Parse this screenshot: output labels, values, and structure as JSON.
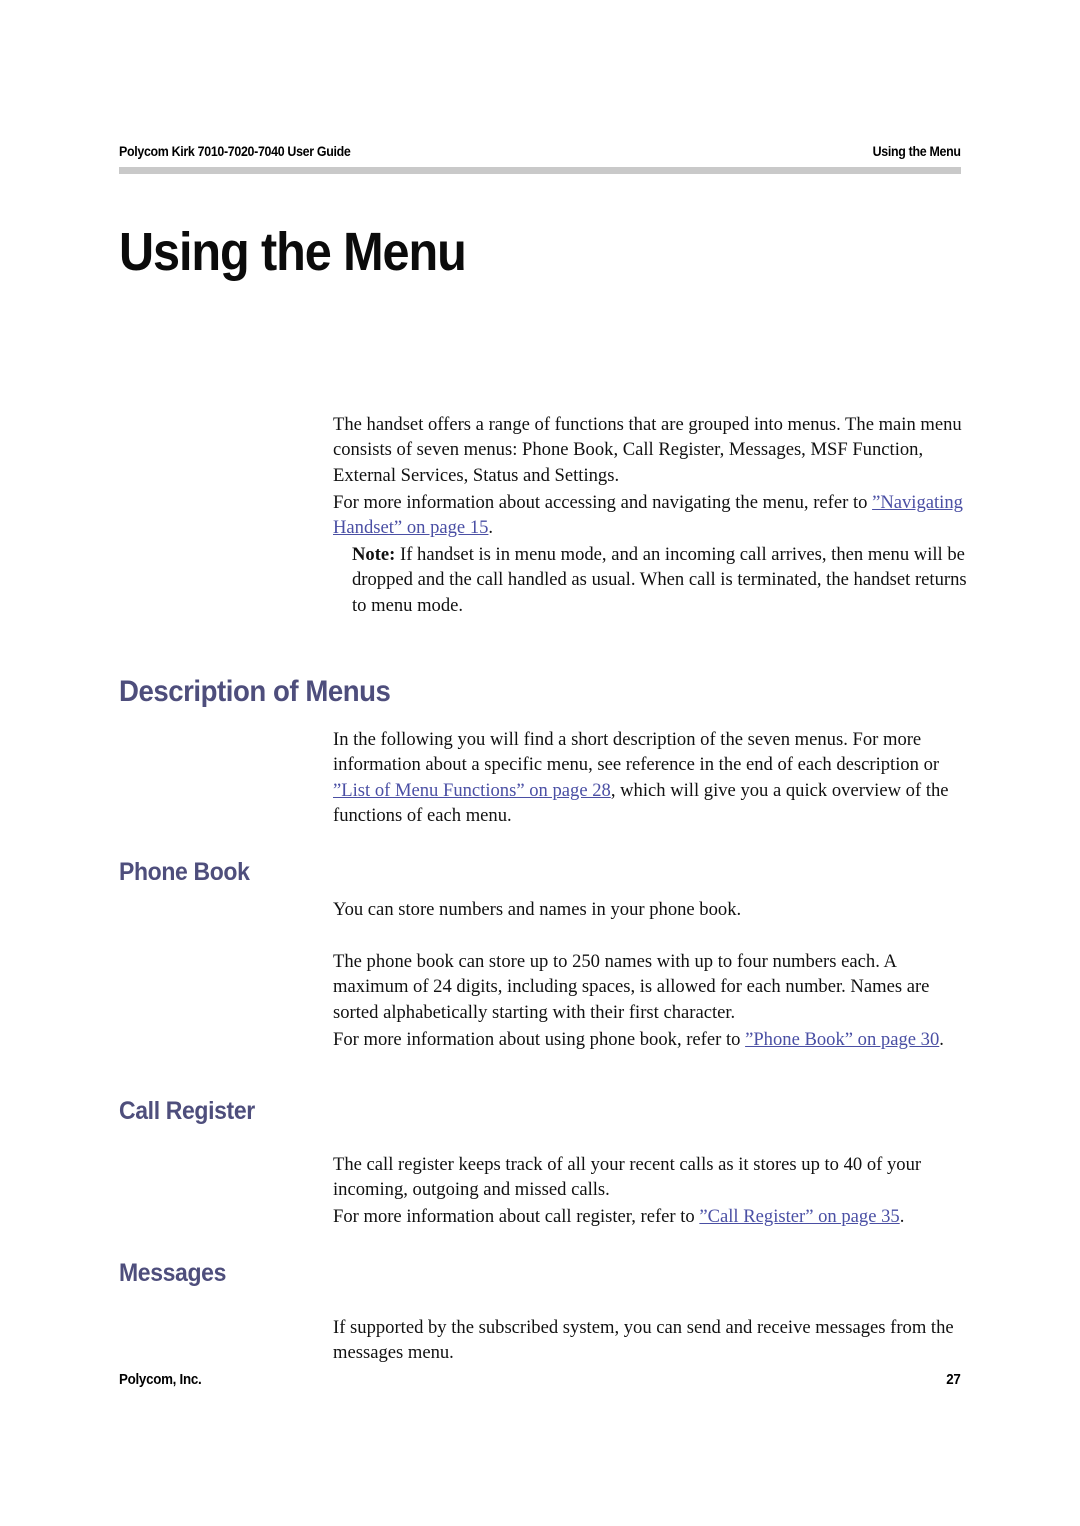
{
  "header": {
    "left": "Polycom Kirk 7010-7020-7040 User Guide",
    "right": "Using the Menu"
  },
  "chapter": {
    "title": "Using the Menu"
  },
  "intro": {
    "paragraph_1": "The handset offers a range of functions that are grouped into menus. The main menu consists of seven menus: Phone Book, Call Register, Messages, MSF Function, External Services, Status and Settings.",
    "paragraph_2_lead": "For more information about accessing and navigating the menu, refer to ",
    "paragraph_2_xref": "”Navigating Handset” on page 15",
    "paragraph_2_tail": ".",
    "note_label": "Note:",
    "note_text": " If handset is in menu mode, and an incoming call arrives, then menu will be dropped and the call handled as usual. When call is terminated, the handset returns to menu mode."
  },
  "description_of_menus": {
    "heading": "Description of Menus",
    "paragraph_lead": "In the following you will find a short description of the seven menus. For more information about a specific menu, see reference in the end of each description or ",
    "paragraph_xref": "”List of Menu Functions” on page 28",
    "paragraph_tail": ", which will give you a quick overview of the functions of each menu."
  },
  "phone_book": {
    "heading": "Phone Book",
    "paragraph_1": "You can store numbers and names in your phone book.",
    "paragraph_2": "The phone book can store up to 250 names with up to four numbers each. A maximum of 24 digits, including spaces, is allowed for each number. Names are sorted alphabetically starting with their first character.",
    "paragraph_3_lead": "For more information about using phone book, refer to ",
    "paragraph_3_xref": "”Phone Book” on page 30",
    "paragraph_3_tail": "."
  },
  "call_register": {
    "heading": "Call Register",
    "paragraph_1": "The call register keeps track of all your recent calls as it stores up to 40 of your incoming, outgoing and missed calls.",
    "paragraph_2_lead": "For more information about call register, refer to ",
    "paragraph_2_xref": "”Call Register” on page 35",
    "paragraph_2_tail": "."
  },
  "messages": {
    "heading": "Messages",
    "paragraph_1": "If supported by the subscribed system, you can send and receive messages from the messages menu."
  },
  "footer": {
    "left": "Polycom, Inc.",
    "right": "27"
  },
  "colors": {
    "heading_purple": "#4e4e7c",
    "xref_blue": "#4a4fa4",
    "rule_gray": "#c9c9c9",
    "body_black": "#111111"
  }
}
